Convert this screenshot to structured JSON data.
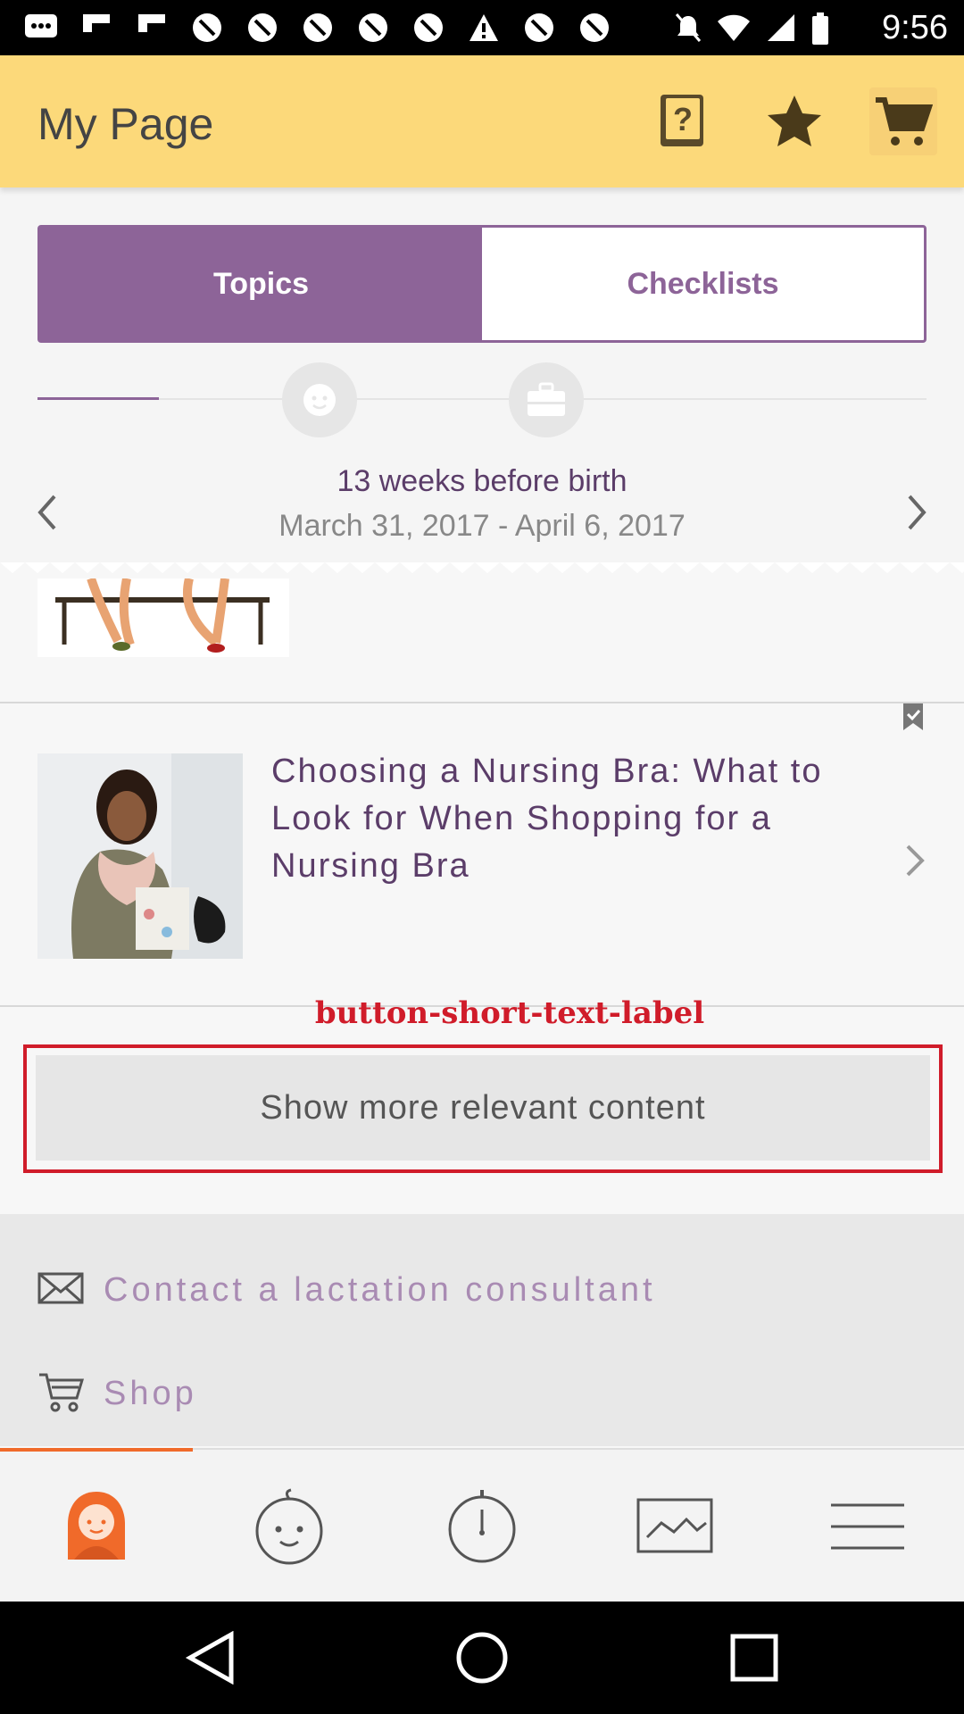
{
  "status_bar": {
    "time": "9:56",
    "left_icons": [
      "messages-icon",
      "flipboard-icon",
      "flipboard-icon",
      "no-sync-icon",
      "no-sync-icon",
      "no-sync-icon",
      "no-sync-icon",
      "no-sync-icon",
      "no-sync-icon",
      "warning-icon",
      "no-sync-icon",
      "no-sync-icon"
    ],
    "right_icons": [
      "silent-icon",
      "wifi-icon",
      "signal-icon",
      "battery-icon"
    ]
  },
  "app_bar": {
    "title": "My Page",
    "actions": [
      "help-book-icon",
      "star-icon",
      "cart-icon"
    ]
  },
  "segmented": {
    "tabs": [
      {
        "label": "Topics",
        "active": true
      },
      {
        "label": "Checklists",
        "active": false
      }
    ]
  },
  "week_nav": {
    "weeks_label": "13 weeks before birth",
    "date_range": "March 31, 2017 - April 6, 2017"
  },
  "article": {
    "title": "Choosing a Nursing Bra: What to Look for When Shopping for a Nursing Bra"
  },
  "annotation": {
    "label": "button-short-text-label"
  },
  "show_more": {
    "label": "Show more relevant content"
  },
  "links": [
    {
      "label": "Contact a lactation consultant",
      "icon": "envelope-icon"
    },
    {
      "label": "Shop",
      "icon": "cart-icon"
    }
  ],
  "bottom_nav": {
    "items": [
      "mother-icon",
      "baby-icon",
      "timer-icon",
      "chart-icon",
      "menu-icon"
    ],
    "active_index": 0
  },
  "colors": {
    "app_bar": "#fcd97a",
    "purple": "#8d6498",
    "orange_accent": "#f06a2a",
    "annotation_red": "#d01c2a"
  }
}
